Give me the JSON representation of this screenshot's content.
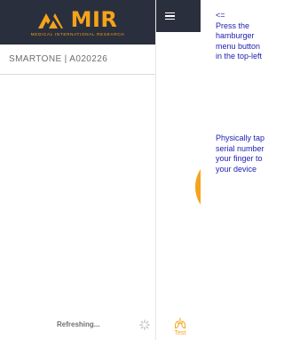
{
  "brand": {
    "name": "MIR",
    "tagline": "MEDICAL INTERNATIONAL RESEARCH",
    "color": "#f5a31a",
    "logo_icon": "mir-logo-icon"
  },
  "device": {
    "label": "SMARTONE | A020226"
  },
  "status": {
    "refreshing_text": "Refreshing...",
    "spinner_icon": "spinner-icon"
  },
  "topbar": {
    "menu_icon": "hamburger-menu-icon",
    "background": "#2a2f3d"
  },
  "tabs": [
    {
      "label": "Test",
      "icon": "lungs-icon",
      "color": "#f5a31a"
    }
  ],
  "hints": {
    "arrow": "<=",
    "menu_instruction": [
      "Press the",
      "hamburger",
      "menu button",
      "in the top-left"
    ],
    "tap_instruction": [
      "Physically tap",
      "serial number",
      "your finger to",
      "your device"
    ],
    "color": "#1c1cb2"
  }
}
